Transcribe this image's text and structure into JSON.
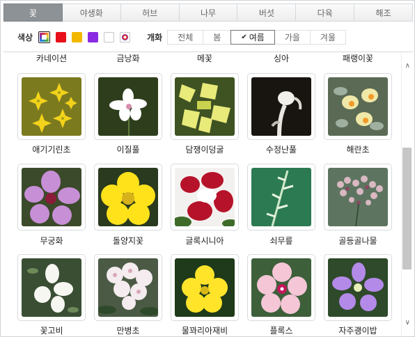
{
  "tabs": [
    {
      "label": "꽃",
      "active": true
    },
    {
      "label": "야생화",
      "active": false
    },
    {
      "label": "허브",
      "active": false
    },
    {
      "label": "나무",
      "active": false
    },
    {
      "label": "버섯",
      "active": false
    },
    {
      "label": "다육",
      "active": false
    },
    {
      "label": "해조",
      "active": false
    }
  ],
  "filters": {
    "color_label": "색상",
    "colors": [
      {
        "name": "all",
        "selected": true
      },
      {
        "name": "red",
        "hex": "#e8101a"
      },
      {
        "name": "yellow",
        "hex": "#f2b800"
      },
      {
        "name": "purple",
        "hex": "#8a2be2"
      },
      {
        "name": "white",
        "hex": "#ffffff"
      },
      {
        "name": "mixed"
      }
    ],
    "season_label": "개화",
    "seasons": [
      {
        "label": "전체",
        "active": false
      },
      {
        "label": "봄",
        "active": false
      },
      {
        "label": "여름",
        "active": true
      },
      {
        "label": "가을",
        "active": false
      },
      {
        "label": "겨울",
        "active": false
      }
    ],
    "check_icon": "✔"
  },
  "top_partial_captions": [
    "카네이션",
    "금낭화",
    "메꽃",
    "싱아",
    "패랭이꽃"
  ],
  "rows": [
    [
      {
        "name": "애기기린초",
        "color": "yellow"
      },
      {
        "name": "이질풀",
        "color": "white"
      },
      {
        "name": "담쟁이덩굴",
        "color": "yellow"
      },
      {
        "name": "수정난풀",
        "color": "white"
      },
      {
        "name": "해란초",
        "color": "yellow"
      }
    ],
    [
      {
        "name": "무궁화",
        "color": "purple"
      },
      {
        "name": "돌양지꽃",
        "color": "yellow"
      },
      {
        "name": "글록시니아",
        "color": "red"
      },
      {
        "name": "쇠무릎",
        "color": "white"
      },
      {
        "name": "골등골나물",
        "color": "mixed"
      }
    ],
    [
      {
        "name": "꽃고비",
        "color": "white"
      },
      {
        "name": "만병초",
        "color": "white"
      },
      {
        "name": "물꽈리아재비",
        "color": "yellow"
      },
      {
        "name": "플록스",
        "color": "red"
      },
      {
        "name": "자주괭이밥",
        "color": "purple"
      }
    ]
  ],
  "scrollbar": {
    "up_icon": "∧",
    "down_icon": "∨"
  }
}
